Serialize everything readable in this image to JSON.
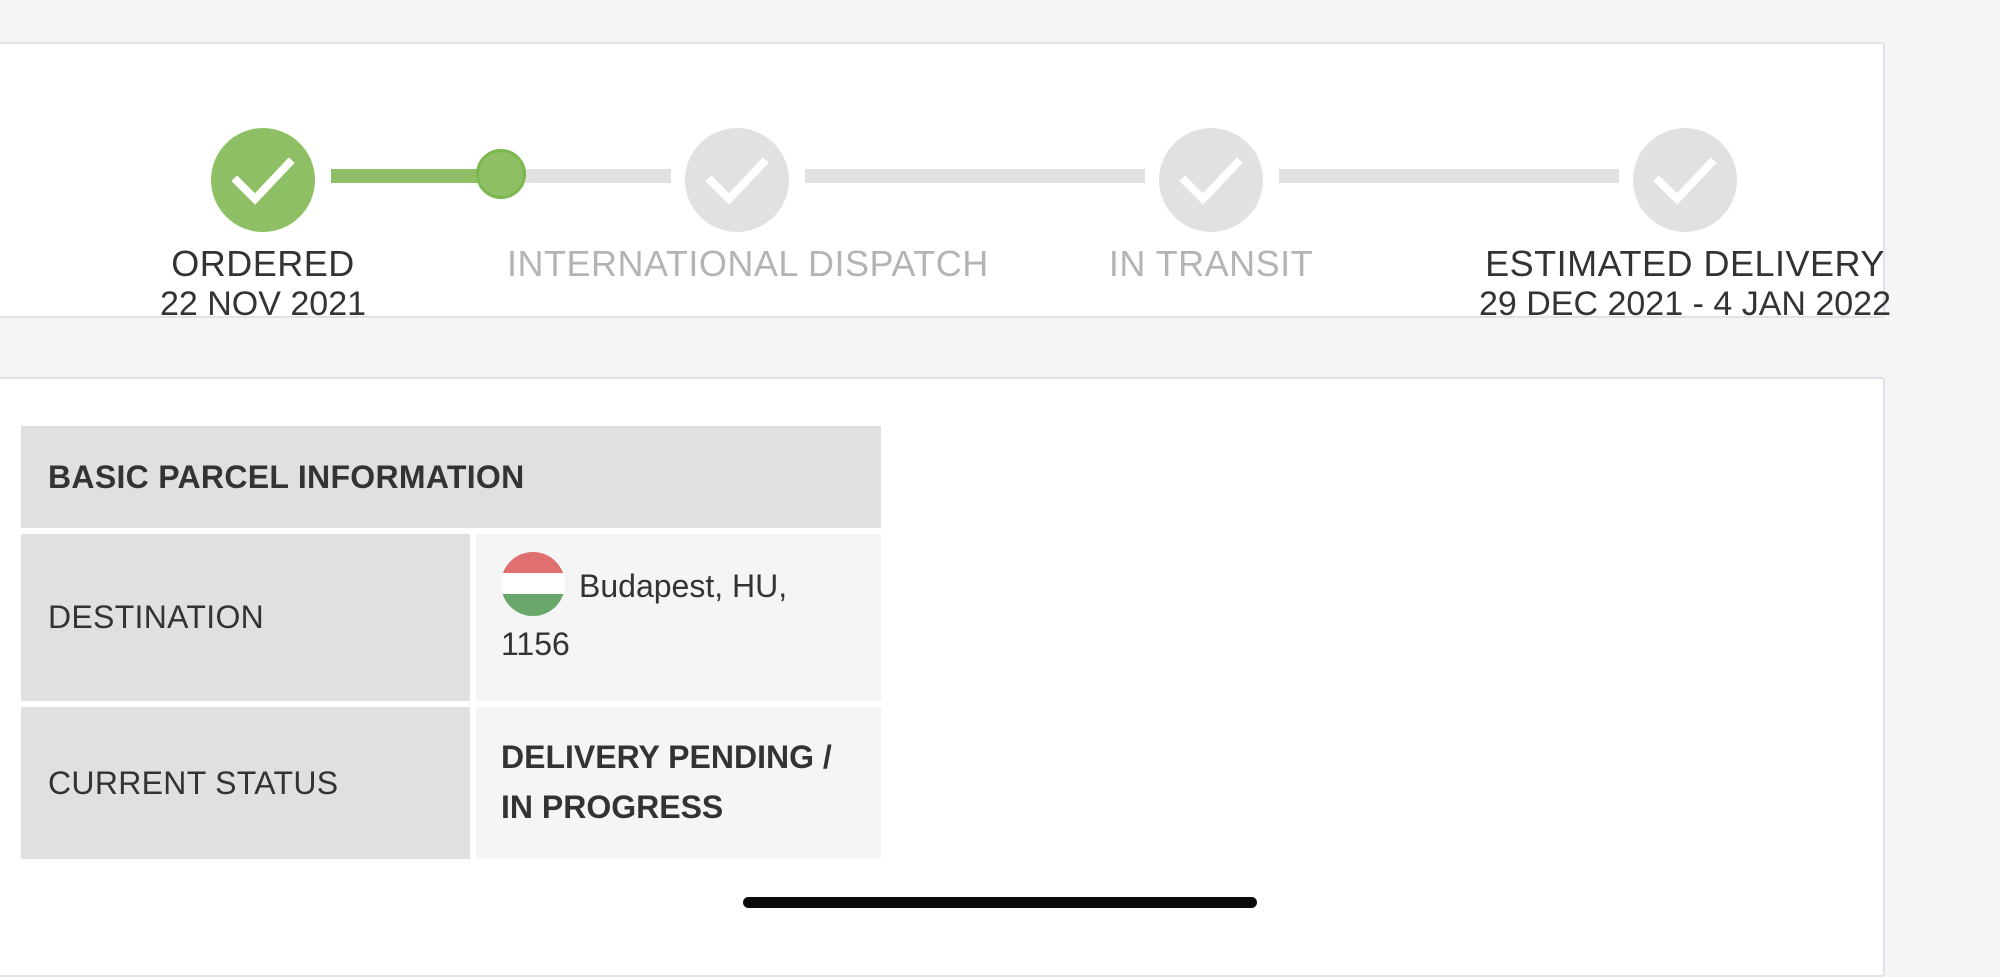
{
  "progress": {
    "steps": [
      {
        "label": "ORDERED",
        "date": "22 NOV 2021",
        "status": "done",
        "icon": "check-icon"
      },
      {
        "label": "INTERNATIONAL DISPATCH",
        "date": "",
        "status": "pending",
        "icon": "check-icon"
      },
      {
        "label": "IN TRANSIT",
        "date": "",
        "status": "pending",
        "icon": "check-icon"
      },
      {
        "label": "ESTIMATED DELIVERY",
        "date": "29 DEC 2021 - 4 JAN 2022",
        "status": "pending",
        "icon": "check-icon"
      }
    ],
    "first_segment_progress": 0.5,
    "colors": {
      "done": "#8ebf64",
      "pending": "#e1e1e1",
      "label_inactive": "#b4b4b4"
    }
  },
  "parcel_info": {
    "title": "BASIC PARCEL INFORMATION",
    "rows": [
      {
        "label": "DESTINATION",
        "value": "Budapest, HU, 1156",
        "flag": "hungary-flag-icon"
      },
      {
        "label": "CURRENT STATUS",
        "value": "DELIVERY PENDING / IN PROGRESS"
      }
    ],
    "flag_colors": [
      "#e07070",
      "#ffffff",
      "#6aa76a"
    ]
  }
}
